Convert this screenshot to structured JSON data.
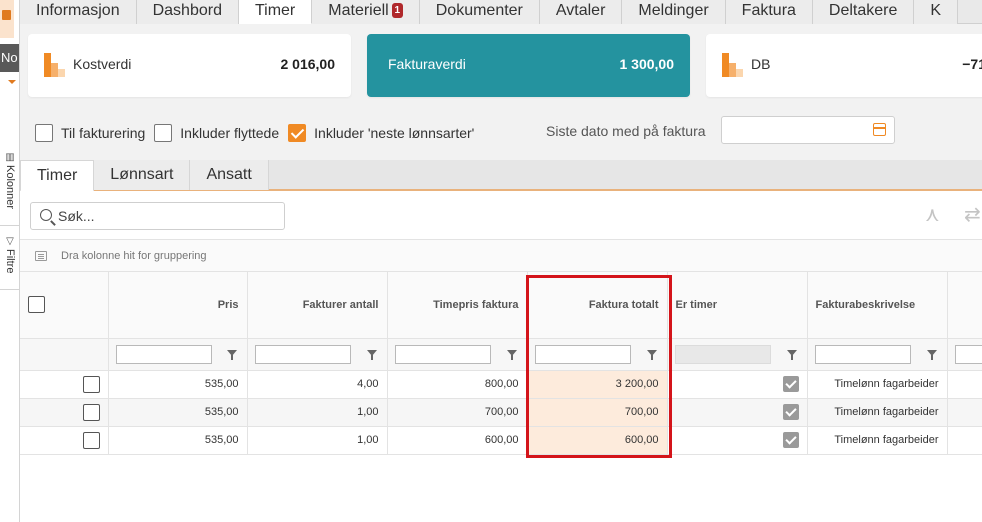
{
  "left_rail": {
    "dark_label": "No",
    "kolonner": "Kolonner",
    "filtre": "Filtre"
  },
  "top_tabs": [
    {
      "label": "Informasjon",
      "active": false
    },
    {
      "label": "Dashbord",
      "active": false
    },
    {
      "label": "Timer",
      "active": true
    },
    {
      "label": "Materiell",
      "active": false,
      "badge": "1"
    },
    {
      "label": "Dokumenter",
      "active": false
    },
    {
      "label": "Avtaler",
      "active": false
    },
    {
      "label": "Meldinger",
      "active": false
    },
    {
      "label": "Faktura",
      "active": false
    },
    {
      "label": "Deltakere",
      "active": false
    },
    {
      "label": "K",
      "active": false
    }
  ],
  "cards": {
    "kostverdi": {
      "label": "Kostverdi",
      "value": "2 016,00"
    },
    "fakturaverdi": {
      "label": "Fakturaverdi",
      "value": "1 300,00"
    },
    "db": {
      "label": "DB",
      "value": "−71"
    }
  },
  "filters": {
    "til_fakturering": {
      "label": "Til fakturering",
      "checked": false
    },
    "inkluder_flyttede": {
      "label": "Inkluder flyttede",
      "checked": false
    },
    "inkluder_neste": {
      "label": "Inkluder 'neste lønnsarter'",
      "checked": true
    },
    "siste_dato_label": "Siste dato med på faktura",
    "siste_dato_value": ""
  },
  "sub_tabs": [
    {
      "label": "Timer",
      "active": true
    },
    {
      "label": "Lønnsart",
      "active": false
    },
    {
      "label": "Ansatt",
      "active": false
    }
  ],
  "search": {
    "placeholder": "Søk..."
  },
  "group_bar": {
    "text": "Dra kolonne hit for gruppering"
  },
  "grid": {
    "columns": [
      "",
      "Pris",
      "Fakturer antall",
      "Timepris faktura",
      "Faktura totalt",
      "Er timer",
      "Fakturabeskrivelse",
      ""
    ],
    "rows": [
      {
        "pris": "535,00",
        "antall": "4,00",
        "timepris": "800,00",
        "totalt": "3 200,00",
        "er_timer": true,
        "beskrivelse": "Timelønn fagarbeider"
      },
      {
        "pris": "535,00",
        "antall": "1,00",
        "timepris": "700,00",
        "totalt": "700,00",
        "er_timer": true,
        "beskrivelse": "Timelønn fagarbeider"
      },
      {
        "pris": "535,00",
        "antall": "1,00",
        "timepris": "600,00",
        "totalt": "600,00",
        "er_timer": true,
        "beskrivelse": "Timelønn fagarbeider"
      }
    ]
  },
  "colors": {
    "accent_orange": "#f08a24",
    "teal": "#24939f",
    "highlight_red": "#d4141a",
    "badge_red": "#b0282b"
  }
}
